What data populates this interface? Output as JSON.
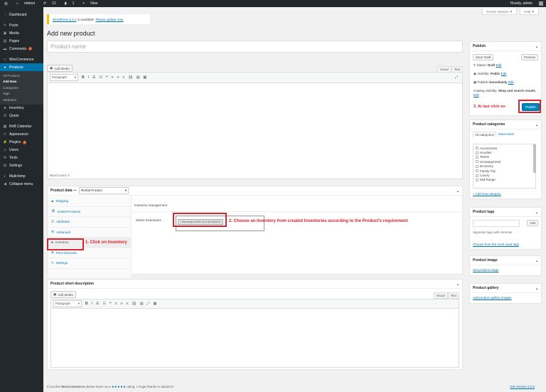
{
  "adminbar": {
    "site_name": "mbtest",
    "updates_count": "12",
    "comments_count": "1",
    "new_label": "New",
    "greeting": "Howdy, admin"
  },
  "sidebar": {
    "items": [
      {
        "label": "Dashboard",
        "icon": "dashboard-icon"
      },
      {
        "label": "Posts",
        "icon": "pin-icon"
      },
      {
        "label": "Media",
        "icon": "media-icon"
      },
      {
        "label": "Pages",
        "icon": "pages-icon"
      },
      {
        "label": "Comments",
        "icon": "comments-icon",
        "badge": "1"
      },
      {
        "label": "WooCommerce",
        "icon": "woocommerce-icon"
      },
      {
        "label": "Products",
        "icon": "archive-icon"
      }
    ],
    "submenu": [
      "All Products",
      "Add New",
      "Categories",
      "Tags",
      "Attributes"
    ],
    "items2": [
      {
        "label": "Inventory",
        "icon": "inventory-icon"
      },
      {
        "label": "Quote",
        "icon": "quote-icon"
      },
      {
        "label": "RnB Calendar",
        "icon": "calendar-icon"
      },
      {
        "label": "Appearance",
        "icon": "brush-icon"
      },
      {
        "label": "Plugins",
        "icon": "plugin-icon",
        "badge": "3"
      },
      {
        "label": "Users",
        "icon": "users-icon"
      },
      {
        "label": "Tools",
        "icon": "tools-icon"
      },
      {
        "label": "Settings",
        "icon": "settings-icon"
      },
      {
        "label": "Mailchimp",
        "icon": "mailchimp-icon"
      },
      {
        "label": "Collapse menu",
        "icon": "collapse-icon"
      }
    ]
  },
  "screen_options": "Screen Options ▼",
  "help": "Help ▼",
  "notice": {
    "prefix": "WordPress 5.2.2",
    "text": " is available! ",
    "link": "Please update now."
  },
  "page_title": "Add new product",
  "product_name_placeholder": "Product name",
  "editor": {
    "add_media": "Add Media",
    "tab_visual": "Visual",
    "tab_text": "Text",
    "format": "Paragraph",
    "word_count": "Word count: 0"
  },
  "product_data": {
    "label": "Product data —",
    "type": "Rental Product",
    "tabs": [
      "Shipping",
      "Linked Products",
      "Attributes",
      "Advanced",
      "Inventory",
      "Price Discount",
      "Settings"
    ],
    "tab_icons": [
      "truck-icon",
      "link-icon",
      "list-icon",
      "gear-icon",
      "inventory-icon",
      "tag-icon",
      "wrench-icon"
    ],
    "section_title": "Inventory management",
    "select_label": "Select Inventories",
    "selected_value": "× Mercedes AMG GLA 45 4MATIC"
  },
  "annotations": {
    "step1": "1. Click on Inventory",
    "step2": "2. Choose an Inventory from created Inventories according to the Product's requirement",
    "step3": "3. At last click on"
  },
  "short_desc": {
    "title": "Product short description",
    "add_media": "Add Media",
    "tab_visual": "Visual",
    "tab_text": "Text",
    "format": "Paragraph"
  },
  "publish": {
    "title": "Publish",
    "save_draft": "Save Draft",
    "preview": "Preview",
    "status_label": "Status: ",
    "status_value": "Draft",
    "visibility_label": "Visibility: ",
    "visibility_value": "Public",
    "publish_label": "Publish ",
    "publish_value": "immediately",
    "edit": "Edit",
    "catalog_label": "Catalog visibility: ",
    "catalog_value": "Shop and search results",
    "publish_button": "Publish"
  },
  "categories": {
    "title": "Product categories",
    "tab_all": "All categories",
    "tab_most": "Most Used",
    "list": [
      "Accessories",
      "Hoodies",
      "Tshirts",
      "Uncategorized",
      "Economy",
      "Family Trip",
      "Luxury",
      "Mid Range"
    ],
    "add_new": "+ Add new category"
  },
  "tags": {
    "title": "Product tags",
    "add": "Add",
    "hint": "Separate tags with commas",
    "choose": "Choose from the most used tags"
  },
  "image": {
    "title": "Product image",
    "link": "Set product image"
  },
  "gallery": {
    "title": "Product gallery",
    "link": "Add product gallery images"
  },
  "footer": {
    "prefix": "If you like ",
    "brand": "WooCommerce",
    "middle": " please leave us a ",
    "stars": "★★★★★",
    "suffix": " rating. A huge thanks in advance!",
    "version": "Get Version 5.2.2"
  },
  "colors": {
    "accent": "#0073aa",
    "annotation": "#d9232f",
    "sidebar": "#23282d"
  }
}
